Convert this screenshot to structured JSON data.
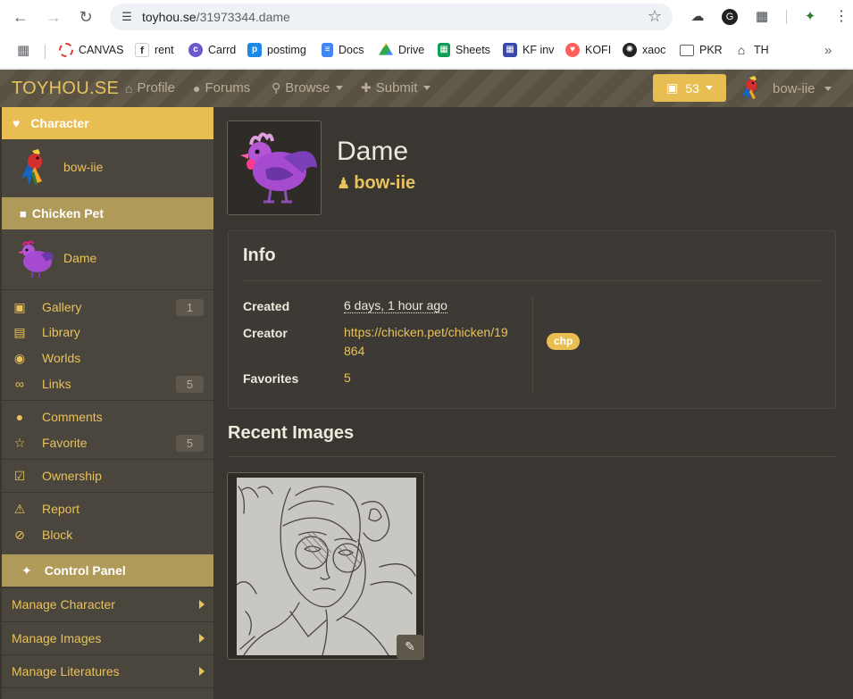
{
  "browser": {
    "url_host": "toyhou.se",
    "url_path": "/31973344.dame",
    "bookmarks": [
      {
        "label": "CANVAS",
        "color": "#e53935"
      },
      {
        "label": "rent",
        "color": "#222222"
      },
      {
        "label": "Carrd",
        "color": "#6a5acd"
      },
      {
        "label": "postimg",
        "color": "#1e88e5"
      },
      {
        "label": "Docs",
        "color": "#4285f4"
      },
      {
        "label": "Drive",
        "color": "#34a853"
      },
      {
        "label": "Sheets",
        "color": "#0f9d58"
      },
      {
        "label": "KF inv",
        "color": "#3949ab"
      },
      {
        "label": "KOFI",
        "color": "#ff5e5b"
      },
      {
        "label": "xaoc",
        "color": "#222222"
      },
      {
        "label": "PKR",
        "color": "#5f6368"
      },
      {
        "label": "TH",
        "color": "#222222"
      }
    ]
  },
  "header": {
    "brand": "TOYHOU.SE",
    "nav": [
      {
        "label": "Profile",
        "icon": "home-icon"
      },
      {
        "label": "Forums",
        "icon": "comments-icon"
      },
      {
        "label": "Browse",
        "icon": "search-icon"
      },
      {
        "label": "Submit",
        "icon": "plus-icon"
      }
    ],
    "notifications": "53",
    "username": "bow-iie"
  },
  "sidebar": {
    "character_label": "Character",
    "owner_name": "bow-iie",
    "folder_label": "Chicken Pet",
    "character_name": "Dame",
    "items": [
      {
        "label": "Gallery",
        "badge": "1",
        "icon": "image-icon"
      },
      {
        "label": "Library",
        "badge": "",
        "icon": "book-icon"
      },
      {
        "label": "Worlds",
        "badge": "",
        "icon": "globe-icon"
      },
      {
        "label": "Links",
        "badge": "5",
        "icon": "link-icon"
      },
      {
        "label": "Comments",
        "badge": "",
        "icon": "comment-icon"
      },
      {
        "label": "Favorite",
        "badge": "5",
        "icon": "star-icon"
      },
      {
        "label": "Ownership",
        "badge": "",
        "icon": "checkbox-icon"
      },
      {
        "label": "Report",
        "badge": "",
        "icon": "warning-icon"
      },
      {
        "label": "Block",
        "badge": "",
        "icon": "block-icon"
      }
    ],
    "control_panel_label": "Control Panel",
    "manage": [
      "Manage Character",
      "Manage Images",
      "Manage Literatures"
    ]
  },
  "main": {
    "name": "Dame",
    "owner": "bow-iie",
    "info_title": "Info",
    "created_label": "Created",
    "created_value": "6 days, 1 hour ago",
    "creator_label": "Creator",
    "creator_line1": "https://chicken.pet/chicken/19",
    "creator_line2": "864",
    "favorites_label": "Favorites",
    "favorites_value": "5",
    "tag": "chp",
    "recent_title": "Recent Images"
  },
  "colors": {
    "accent": "#e8c25a",
    "header_bg": "#5c5444",
    "sidebar_bg": "#4a453d",
    "page_bg": "#3a3632"
  }
}
